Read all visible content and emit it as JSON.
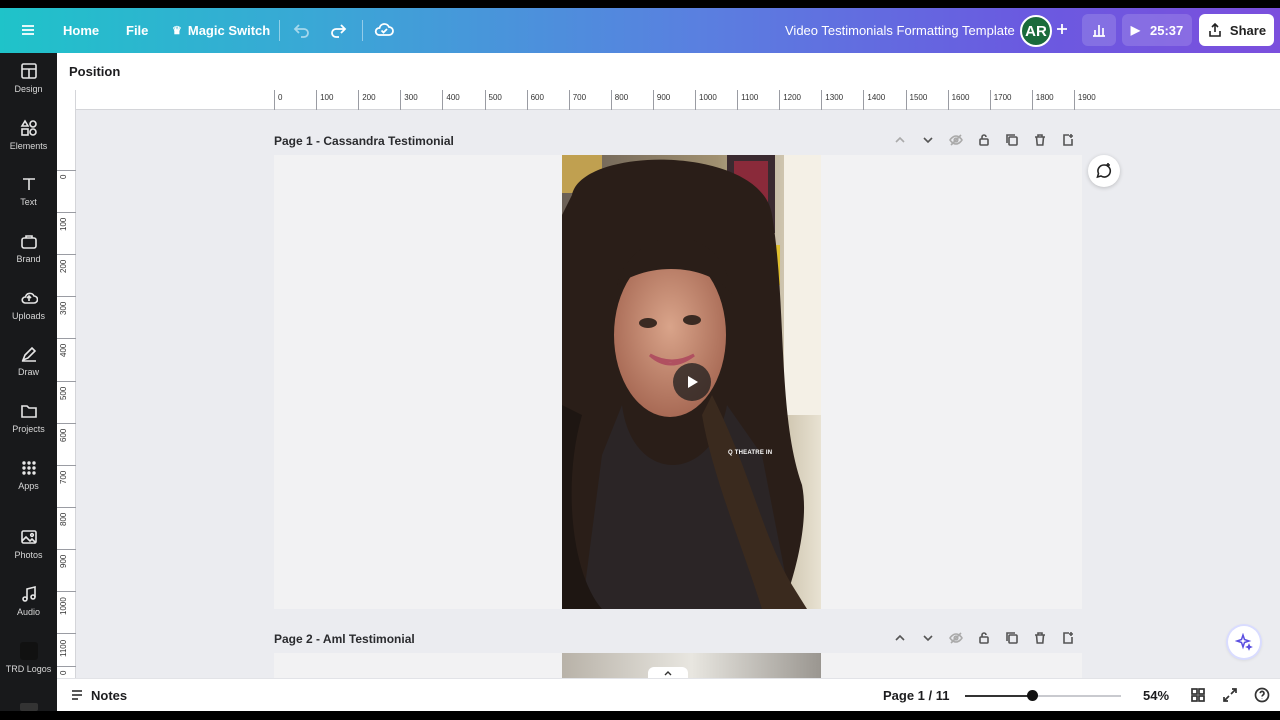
{
  "topbar": {
    "home": "Home",
    "file": "File",
    "magic_switch": "Magic Switch",
    "doc_title": "Video Testimonials Formatting Template",
    "avatar": "AR",
    "timer": "25:37",
    "share": "Share"
  },
  "context": {
    "position": "Position"
  },
  "sidebar": {
    "items": [
      {
        "label": "Design",
        "icon": "design-icon"
      },
      {
        "label": "Elements",
        "icon": "elements-icon"
      },
      {
        "label": "Text",
        "icon": "text-icon"
      },
      {
        "label": "Brand",
        "icon": "brand-icon"
      },
      {
        "label": "Uploads",
        "icon": "uploads-icon"
      },
      {
        "label": "Draw",
        "icon": "draw-icon"
      },
      {
        "label": "Projects",
        "icon": "folder-icon"
      },
      {
        "label": "Apps",
        "icon": "apps-icon"
      },
      {
        "label": "Photos",
        "icon": "photos-icon"
      },
      {
        "label": "Audio",
        "icon": "audio-icon"
      },
      {
        "label": "TRD Logos",
        "icon": "logo-icon"
      }
    ]
  },
  "ruler": {
    "h": [
      "0",
      "100",
      "200",
      "300",
      "400",
      "500",
      "600",
      "700",
      "800",
      "900",
      "1000",
      "1100",
      "1200",
      "1300",
      "1400",
      "1500",
      "1600",
      "1700",
      "1800",
      "1900"
    ],
    "v": [
      "0",
      "100",
      "200",
      "300",
      "400",
      "500",
      "600",
      "700",
      "800",
      "900",
      "1000",
      "1100",
      "0"
    ]
  },
  "pages": [
    {
      "label": "Page 1 - Cassandra Testimonial",
      "overlay": "Q THEATRE IN"
    },
    {
      "label": "Page 2 - Aml Testimonial"
    }
  ],
  "bottom": {
    "notes": "Notes",
    "page_count": "Page 1 / 11",
    "zoom": "54%",
    "zoom_level": 0.43
  }
}
